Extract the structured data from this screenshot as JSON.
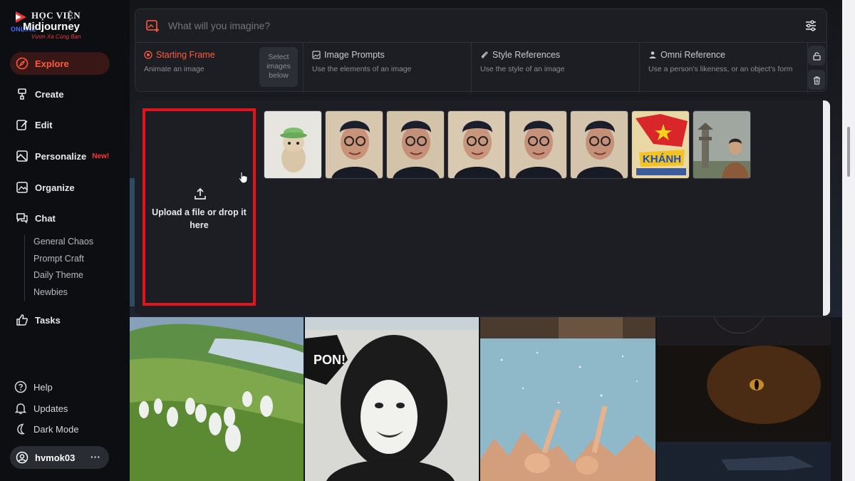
{
  "logo": {
    "top": "HỌC VIỆN",
    "main": "Midjourney",
    "online": "ONLINE",
    "slogan": "Vươn Xa Cùng Bạn"
  },
  "nav": {
    "explore": "Explore",
    "create": "Create",
    "edit": "Edit",
    "personalize": "Personalize",
    "personalize_badge": "New!",
    "organize": "Organize",
    "chat": "Chat",
    "chat_rooms": [
      "General Chaos",
      "Prompt Craft",
      "Daily Theme",
      "Newbies"
    ],
    "tasks": "Tasks"
  },
  "footer": {
    "help": "Help",
    "updates": "Updates",
    "dark_mode": "Dark Mode",
    "username": "hvmok03",
    "more": "···"
  },
  "prompt": {
    "placeholder": "What will you imagine?"
  },
  "references": [
    {
      "title": "Starting Frame",
      "desc": "Animate an image",
      "hint": "Select images below"
    },
    {
      "title": "Image Prompts",
      "desc": "Use the elements of an image"
    },
    {
      "title": "Style References",
      "desc": "Use the style of an image"
    },
    {
      "title": "Omni Reference",
      "desc": "Use a person's likeness, or an object's form"
    }
  ],
  "upload": {
    "text": "Upload a file or drop it here"
  },
  "thumbnails": [
    "plush-creature",
    "elder-portrait",
    "elder-portrait",
    "elder-portrait",
    "elder-portrait",
    "elder-portrait",
    "comic-poster",
    "temple-portrait"
  ],
  "colors": {
    "accent": "#ff5a3d",
    "highlight_border": "#e0141b",
    "sidebar_bg": "#0d0e12",
    "panel_bg": "#1d1e24"
  }
}
